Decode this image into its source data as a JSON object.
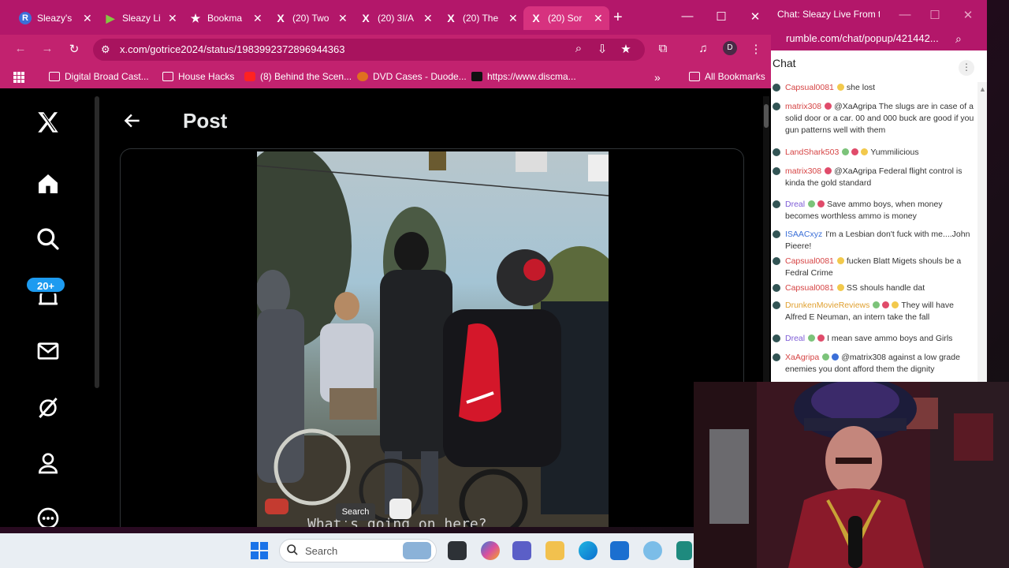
{
  "browser": {
    "tabs": [
      {
        "title": "Sleazy's",
        "icon": "rumble-r-icon",
        "color": "#3b6fd8",
        "glyph": "R"
      },
      {
        "title": "Sleazy Li",
        "icon": "rumble-play-icon",
        "color": "#85c742",
        "glyph": "▶"
      },
      {
        "title": "Bookma",
        "icon": "star-icon",
        "color": "transparent",
        "glyph": "★"
      },
      {
        "title": "(20) Two",
        "icon": "x-logo-icon",
        "color": "transparent",
        "glyph": "𝕏"
      },
      {
        "title": "(20) 3I/A",
        "icon": "x-logo-icon",
        "color": "transparent",
        "glyph": "𝕏"
      },
      {
        "title": "(20) The",
        "icon": "x-logo-icon",
        "color": "transparent",
        "glyph": "𝕏"
      },
      {
        "title": "(20) Sor",
        "icon": "x-logo-icon",
        "color": "transparent",
        "glyph": "𝕏"
      }
    ],
    "url": "x.com/gotrice2024/status/1983992372896944363",
    "profile_initial": "D",
    "bookmarks": [
      {
        "label": "Digital Broad Cast..."
      },
      {
        "label": "House Hacks"
      },
      {
        "label": "(8) Behind the Scen..."
      },
      {
        "label": "DVD Cases - Duode..."
      },
      {
        "label": "https://www.discma..."
      }
    ],
    "all_bookmarks": "All Bookmarks"
  },
  "xpage": {
    "title": "Post",
    "notif_count": "20+",
    "caption": "What's going on here?"
  },
  "tooltip": "Search",
  "chat": {
    "window_title": "Chat: Sleazy Live From th...",
    "url": "rumble.com/chat/popup/421442...",
    "header": "Chat",
    "messages": [
      {
        "user": "Capsual0081",
        "color": "#d64545",
        "badges": [
          "#f2c94c"
        ],
        "text": "she lost"
      },
      {
        "user": "matrix308",
        "color": "#d64545",
        "badges": [
          "#e04b6a"
        ],
        "text": "@XaAgripa The slugs are in case of a solid door or a car. 00 and 000 buck are good if you gun patterns well with them"
      },
      {
        "user": "LandShark503",
        "color": "#d64545",
        "badges": [
          "#7cc37a",
          "#e04b6a",
          "#f2c94c"
        ],
        "text": "Yummilicious"
      },
      {
        "user": "matrix308",
        "color": "#d64545",
        "badges": [
          "#e04b6a"
        ],
        "text": "@XaAgripa Federal flight control is kinda the gold standard"
      },
      {
        "user": "Dreal",
        "color": "#7d5bd6",
        "badges": [
          "#7cc37a",
          "#e04b6a"
        ],
        "text": "Save ammo boys, when money becomes worthless ammo is money"
      },
      {
        "user": "ISAACxyz",
        "color": "#3b6fd8",
        "badges": [],
        "text": "I'm a Lesbian don't fuck with me....John Pieere!"
      },
      {
        "user": "Capsual0081",
        "color": "#d64545",
        "badges": [
          "#f2c94c"
        ],
        "text": "fucken Blatt Migets shouls be a Fedral Crime"
      },
      {
        "user": "Capsual0081",
        "color": "#d64545",
        "badges": [
          "#f2c94c"
        ],
        "text": "SS shouls handle dat"
      },
      {
        "user": "DrunkenMovieReviews",
        "color": "#e0a030",
        "badges": [
          "#7cc37a",
          "#e04b6a",
          "#f2c94c"
        ],
        "text": "They will have Alfred E Neuman, an intern take the fall"
      },
      {
        "user": "Dreal",
        "color": "#7d5bd6",
        "badges": [
          "#7cc37a",
          "#e04b6a"
        ],
        "text": "I mean save ammo boys and Girls"
      },
      {
        "user": "XaAgripa",
        "color": "#d64545",
        "badges": [
          "#7cc37a",
          "#3b6fd8"
        ],
        "text": "@matrix308 against a low grade enemies you dont afford them the dignity"
      }
    ]
  },
  "taskbar": {
    "search_placeholder": "Search"
  },
  "colors": {
    "chrome": "#c2226f",
    "tabstrip": "#b3176a",
    "x_blue": "#1d9bf0"
  }
}
